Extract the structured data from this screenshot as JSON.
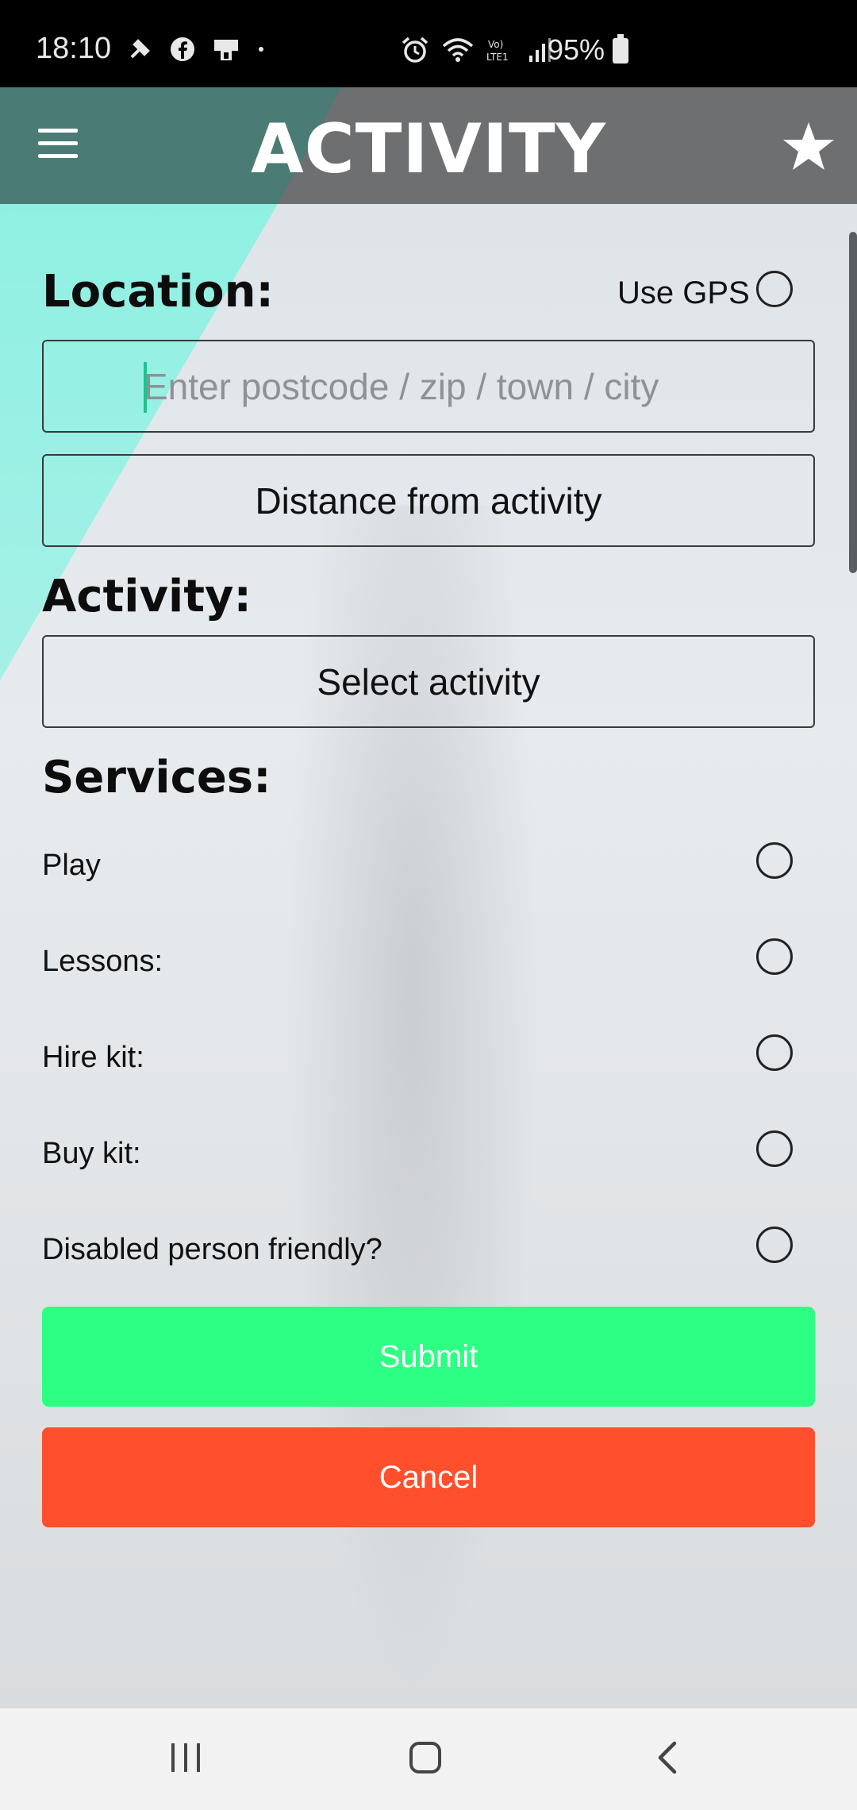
{
  "status_bar": {
    "time": "18:10",
    "battery": "95%",
    "notification_icons": [
      "tools-icon",
      "facebook-icon",
      "clipboard-icon",
      "dot-icon"
    ],
    "system_icons": [
      "alarm-icon",
      "wifi-icon",
      "volte-lte-icon",
      "signal-icon"
    ]
  },
  "app_bar": {
    "title": "ACTIVITY",
    "menu_icon": "hamburger-menu-icon",
    "favorite_icon": "star-icon"
  },
  "location": {
    "heading": "Location:",
    "use_gps_label": "Use GPS",
    "input_placeholder": "Enter postcode / zip / town / city",
    "distance_label": "Distance from activity"
  },
  "activity": {
    "heading": "Activity:",
    "select_label": "Select activity"
  },
  "services": {
    "heading": "Services:",
    "items": [
      {
        "label": "Play"
      },
      {
        "label": "Lessons:"
      },
      {
        "label": "Hire kit:"
      },
      {
        "label": "Buy kit:"
      },
      {
        "label": "Disabled person friendly?"
      }
    ]
  },
  "actions": {
    "submit_label": "Submit",
    "cancel_label": "Cancel"
  },
  "colors": {
    "submit": "#2cff83",
    "cancel": "#ff4f2c",
    "header": "#6e6f70",
    "header_accent": "#4a7b74"
  },
  "nav_bar": {
    "icons": [
      "recent-apps-icon",
      "home-icon",
      "back-icon"
    ]
  }
}
